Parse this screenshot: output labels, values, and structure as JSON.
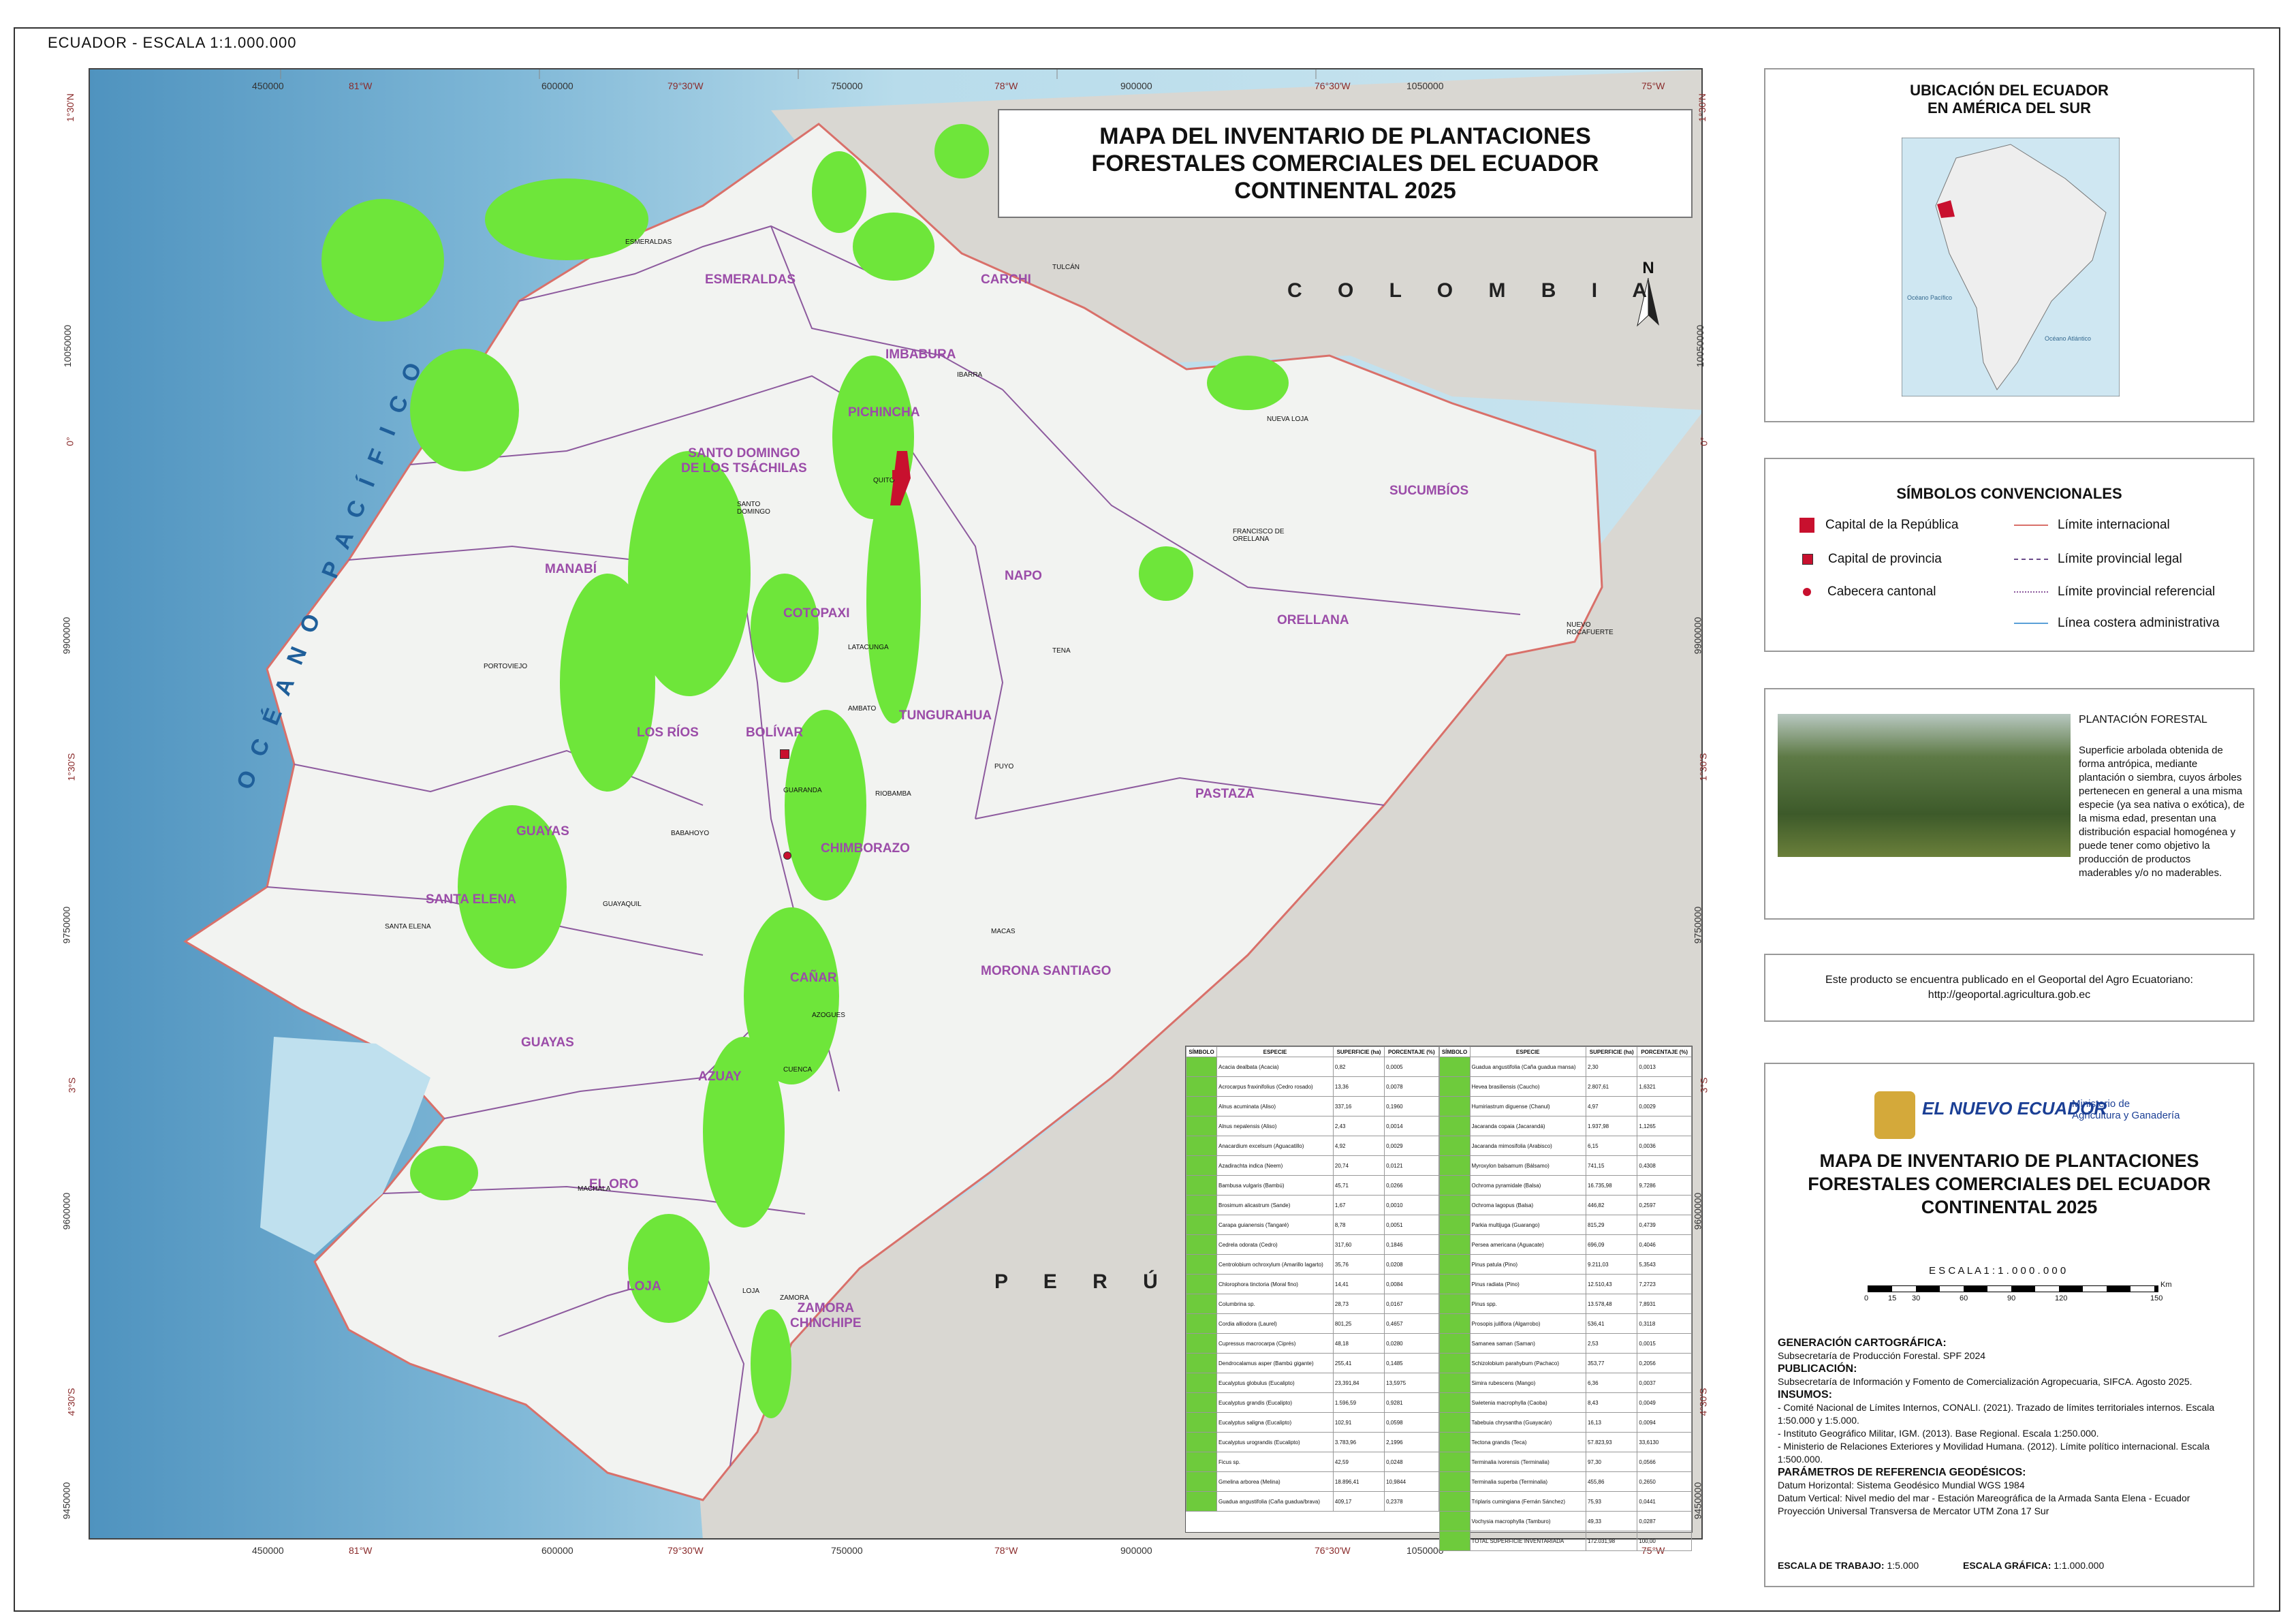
{
  "top_caption": "ECUADOR - ESCALA 1:1.000.000",
  "map_title": "MAPA DEL INVENTARIO DE PLANTACIONES\nFORESTALES COMERCIALES DEL ECUADOR\nCONTINENTAL 2025",
  "north_label": "N",
  "countries": {
    "colombia": "C O L O M B I A",
    "peru": "P E R Ú",
    "ocean": "O C É A N O   P A C Í F I C O"
  },
  "grid_top": [
    "450000",
    "81°W",
    "600000",
    "79°30'W",
    "750000",
    "78°W",
    "900000",
    "76°30'W",
    "1050000",
    "75°W"
  ],
  "grid_bottom": [
    "450000",
    "81°W",
    "600000",
    "79°30'W",
    "750000",
    "78°W",
    "900000",
    "76°30'W",
    "1050000",
    "75°W"
  ],
  "grid_left": [
    "1°30'N",
    "10050000",
    "0°",
    "9900000",
    "1°30'S",
    "9750000",
    "3°S",
    "9600000",
    "4°30'S",
    "9450000"
  ],
  "grid_right": [
    "1°30'N",
    "10050000",
    "0°",
    "9900000",
    "1°30'S",
    "9750000",
    "3°S",
    "9600000",
    "4°30'S",
    "9450000"
  ],
  "provinces": [
    "ESMERALDAS",
    "CARCHI",
    "IMBABURA",
    "PICHINCHA",
    "SANTO DOMINGO\nDE LOS TSÁCHILAS",
    "SUCUMBÍOS",
    "MANABÍ",
    "NAPO",
    "ORELLANA",
    "COTOPAXI",
    "LOS RÍOS",
    "BOLÍVAR",
    "TUNGURAHUA",
    "PASTAZA",
    "GUAYAS",
    "CHIMBORAZO",
    "SANTA ELENA",
    "MORONA SANTIAGO",
    "CAÑAR",
    "GUAYAS",
    "AZUAY",
    "EL ORO",
    "LOJA",
    "ZAMORA\nCHINCHIPE"
  ],
  "cities": [
    "QUITO",
    "ESMERALDAS",
    "TULCÁN",
    "IBARRA",
    "NUEVA LOJA",
    "PORTOVIEJO",
    "LATACUNGA",
    "FRANCISCO DE ORELLANA",
    "TENA",
    "AMBATO",
    "PUYO",
    "GUARANDA",
    "RIOBAMBA",
    "BABAHOYO",
    "SANTA ELENA",
    "GUAYAQUIL",
    "MACAS",
    "AZOGUES",
    "CUENCA",
    "MACHALA",
    "LOJA",
    "ZAMORA",
    "NUEVO ROCAFUERTE",
    "SANTO DOMINGO"
  ],
  "location_panel": {
    "title": "UBICACIÓN DEL ECUADOR\nEN AMÉRICA DEL SUR",
    "ocean_left": "Océano Pacífico",
    "ocean_right": "Océano Atlántico"
  },
  "legend": {
    "title": "SÍMBOLOS CONVENCIONALES",
    "items": [
      {
        "label": "Capital de la República",
        "kind": "capital"
      },
      {
        "label": "Capital de provincia",
        "kind": "prov-capital"
      },
      {
        "label": "Cabecera cantonal",
        "kind": "canton"
      },
      {
        "label": "Límite internacional",
        "kind": "intl"
      },
      {
        "label": "Límite provincial legal",
        "kind": "prov-legal"
      },
      {
        "label": "Límite provincial referencial",
        "kind": "prov-ref"
      },
      {
        "label": "Línea costera administrativa",
        "kind": "coast"
      }
    ]
  },
  "plantacion": {
    "title": "PLANTACIÓN FORESTAL",
    "text": "Superficie arbolada obtenida de forma antrópica, mediante plantación o siembra, cuyos árboles pertenecen en general a una misma especie (ya sea nativa o exótica), de la misma edad, presentan una distribución espacial homogénea y puede tener como objetivo la producción de productos maderables y/o no maderables."
  },
  "geoportal": "Este producto se encuentra publicado en el Geoportal del Agro Ecuatoriano:\nhttp://geoportal.agricultura.gob.ec",
  "ministry": {
    "brand": "EL NUEVO ECUADOR",
    "name": "Ministerio de\nAgricultura y Ganadería"
  },
  "doc_title": "MAPA DE INVENTARIO DE PLANTACIONES\nFORESTALES COMERCIALES DEL ECUADOR\nCONTINENTAL 2025",
  "scale_label": "E S C A L A     1 : 1 . 0 0 0 . 0 0 0",
  "scale_ticks": [
    "0",
    "15",
    "30",
    "60",
    "90",
    "120",
    "150"
  ],
  "scale_unit": "Km",
  "credits": {
    "gen_h": "GENERACIÓN CARTOGRÁFICA:",
    "gen": "Subsecretaría de Producción Forestal. SPF 2024",
    "pub_h": "PUBLICACIÓN:",
    "pub": "Subsecretaría de Información y Fomento de Comercialización Agropecuaria, SIFCA. Agosto 2025.",
    "ins_h": "INSUMOS:",
    "ins": [
      "- Comité Nacional de Límites Internos, CONALI. (2021). Trazado de límites territoriales internos. Escala 1:50.000 y 1:5.000.",
      "- Instituto Geográfico Militar, IGM. (2013). Base Regional. Escala 1:250.000.",
      "- Ministerio de Relaciones Exteriores y Movilidad Humana. (2012). Límite político internacional. Escala 1:500.000."
    ],
    "geo_h": "PARÁMETROS DE REFERENCIA GEODÉSICOS:",
    "geo": [
      "Datum Horizontal: Sistema Geodésico Mundial WGS 1984",
      "Datum Vertical: Nivel medio del mar - Estación Mareográfica de la Armada Santa Elena - Ecuador",
      "Proyección Universal Transversa de Mercator UTM Zona 17 Sur"
    ],
    "work_h": "ESCALA DE TRABAJO:",
    "work": "1:5.000",
    "graf_h": "ESCALA GRÁFICA:",
    "graf": "1:1.000.000"
  },
  "species_table": {
    "headers": [
      "SÍMBOLO",
      "ESPECIE",
      "SUPERFICIE (ha)",
      "PORCENTAJE (%)"
    ],
    "left": [
      [
        "Acacia dealbata (Acacia)",
        "0,82",
        "0,0005"
      ],
      [
        "Acrocarpus fraxinifolius (Cedro rosado)",
        "13,36",
        "0,0078"
      ],
      [
        "Alnus acuminata (Aliso)",
        "337,16",
        "0,1960"
      ],
      [
        "Alnus nepalensis (Aliso)",
        "2,43",
        "0,0014"
      ],
      [
        "Anacardium excelsum (Aguacatillo)",
        "4,92",
        "0,0029"
      ],
      [
        "Azadirachta indica (Neem)",
        "20,74",
        "0,0121"
      ],
      [
        "Bambusa vulgaris (Bambú)",
        "45,71",
        "0,0266"
      ],
      [
        "Brosimum alicastrum (Sande)",
        "1,67",
        "0,0010"
      ],
      [
        "Carapa guianensis (Tangaré)",
        "8,78",
        "0,0051"
      ],
      [
        "Cedrela odorata (Cedro)",
        "317,60",
        "0,1846"
      ],
      [
        "Centrolobium ochroxylum (Amarillo lagarto)",
        "35,76",
        "0,0208"
      ],
      [
        "Chlorophora tinctoria (Moral fino)",
        "14,41",
        "0,0084"
      ],
      [
        "Columbrina sp.",
        "28,73",
        "0,0167"
      ],
      [
        "Cordia alliodora (Laurel)",
        "801,25",
        "0,4657"
      ],
      [
        "Cupressus macrocarpa (Ciprés)",
        "48,18",
        "0,0280"
      ],
      [
        "Dendrocalamus asper (Bambú gigante)",
        "255,41",
        "0,1485"
      ],
      [
        "Eucalyptus globulus (Eucalipto)",
        "23,391,84",
        "13,5975"
      ],
      [
        "Eucalyptus grandis (Eucalipto)",
        "1.596,59",
        "0,9281"
      ],
      [
        "Eucalyptus saligna (Eucalipto)",
        "102,91",
        "0,0598"
      ],
      [
        "Eucalyptus urograndis (Eucalipto)",
        "3.783,96",
        "2,1996"
      ],
      [
        "Ficus sp.",
        "42,59",
        "0,0248"
      ],
      [
        "Gmelina arborea (Melina)",
        "18.896,41",
        "10,9844"
      ],
      [
        "Guadua angustifolia (Caña guadua/brava)",
        "409,17",
        "0,2378"
      ]
    ],
    "right": [
      [
        "Guadua angustifolia (Caña guadua mansa)",
        "2,30",
        "0,0013"
      ],
      [
        "Hevea brasiliensis (Caucho)",
        "2.807,61",
        "1,6321"
      ],
      [
        "Humiriastrum diguense (Chanul)",
        "4,97",
        "0,0029"
      ],
      [
        "Jacaranda copaia (Jacarandá)",
        "1.937,98",
        "1,1265"
      ],
      [
        "Jacaranda mimosifolia (Arabisco)",
        "6,15",
        "0,0036"
      ],
      [
        "Myroxylon balsamum (Bálsamo)",
        "741,15",
        "0,4308"
      ],
      [
        "Ochroma pyramidale (Balsa)",
        "16.735,98",
        "9,7286"
      ],
      [
        "Ochroma lagopus (Balsa)",
        "446,82",
        "0,2597"
      ],
      [
        "Parkia multijuga (Guarango)",
        "815,29",
        "0,4739"
      ],
      [
        "Persea americana (Aguacate)",
        "696,09",
        "0,4046"
      ],
      [
        "Pinus patula (Pino)",
        "9.211,03",
        "5,3543"
      ],
      [
        "Pinus radiata (Pino)",
        "12.510,43",
        "7,2723"
      ],
      [
        "Pinus spp.",
        "13.578,48",
        "7,8931"
      ],
      [
        "Prosopis juliflora (Algarrobo)",
        "536,41",
        "0,3118"
      ],
      [
        "Samanea saman (Saman)",
        "2,53",
        "0,0015"
      ],
      [
        "Schizolobium parahybum (Pachaco)",
        "353,77",
        "0,2056"
      ],
      [
        "Simira rubescens (Mango)",
        "6,36",
        "0,0037"
      ],
      [
        "Swietenia macrophylla (Caoba)",
        "8,43",
        "0,0049"
      ],
      [
        "Tabebuia chrysantha (Guayacán)",
        "16,13",
        "0,0094"
      ],
      [
        "Tectona grandis (Teca)",
        "57.823,93",
        "33,6130"
      ],
      [
        "Terminalia ivorensis (Terminalia)",
        "97,30",
        "0,0566"
      ],
      [
        "Terminalia superba (Terminalia)",
        "455,86",
        "0,2650"
      ],
      [
        "Triplaris cumingiana (Fernán Sánchez)",
        "75,93",
        "0,0441"
      ],
      [
        "Vochysia macrophylla (Tamburo)",
        "49,33",
        "0,0287"
      ],
      [
        "TOTAL SUPERFICIE INVENTARIADA",
        "172.031,98",
        "100,00"
      ]
    ]
  },
  "colors": {
    "ocean": "#a8d2e6",
    "land": "#f2f3f1",
    "neighbor": "#d9d7d2",
    "plantation": "#6ee63a",
    "prov_line": "#8d5a9e",
    "intl_line": "#d9706a",
    "red": "#c8102e"
  }
}
